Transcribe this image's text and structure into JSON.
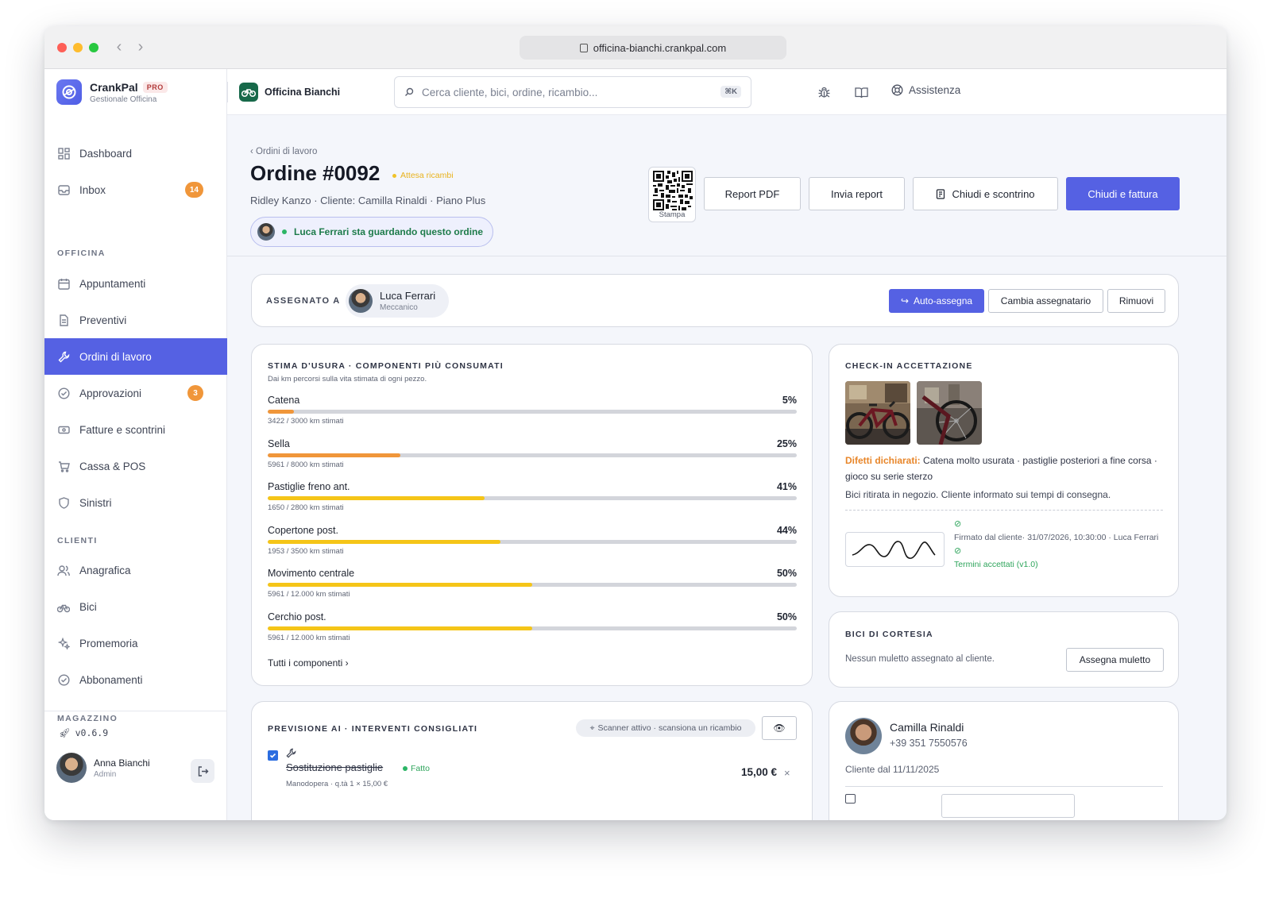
{
  "browser": {
    "url": "officina-bianchi.crankpal.com"
  },
  "brand": {
    "name": "CrankPal",
    "tier": "PRO",
    "subtitle": "Gestionale Officina"
  },
  "sidebar": {
    "items": [
      {
        "label": "Dashboard",
        "icon": "dashboard-icon"
      },
      {
        "label": "Inbox",
        "icon": "inbox-icon",
        "badge": "14"
      },
      {
        "label": "Appuntamenti",
        "icon": "calendar-icon"
      },
      {
        "label": "Preventivi",
        "icon": "document-icon"
      },
      {
        "label": "Ordini di lavoro",
        "icon": "wrench-icon",
        "active": true
      },
      {
        "label": "Approvazioni",
        "icon": "check-circle-icon",
        "badge": "3"
      },
      {
        "label": "Fatture e scontrini",
        "icon": "receipt-icon"
      },
      {
        "label": "Cassa & POS",
        "icon": "cart-icon"
      },
      {
        "label": "Sinistri",
        "icon": "shield-icon"
      },
      {
        "label": "Anagrafica",
        "icon": "users-icon"
      },
      {
        "label": "Bici",
        "icon": "bike-icon"
      },
      {
        "label": "Promemoria",
        "icon": "sparkle-icon"
      },
      {
        "label": "Abbonamenti",
        "icon": "check-circle-icon"
      }
    ],
    "sections": {
      "officina": "OFFICINA",
      "clienti": "CLIENTI",
      "magazzino": "MAGAZZINO"
    },
    "version": "v0.6.9",
    "user": {
      "name": "Anna Bianchi",
      "role": "Admin"
    }
  },
  "topbar": {
    "shop_name": "Officina Bianchi",
    "search_placeholder": "Cerca cliente, bici, ordine, ricambio...",
    "search_shortcut": "⌘K",
    "help_label": "Assistenza"
  },
  "order": {
    "breadcrumb": "‹ Ordini di lavoro",
    "title": "Ordine #0092",
    "status": "Attesa ricambi",
    "subtitle": "Ridley Kanzo · Cliente: Camilla Rinaldi · Piano Plus",
    "watching": "Luca Ferrari sta guardando questo ordine",
    "qr_label": "Stampa",
    "actions": {
      "report_pdf": "Report PDF",
      "send_report": "Invia report",
      "close_receipt": "Chiudi e scontrino",
      "close_invoice": "Chiudi e fattura"
    }
  },
  "assignment": {
    "label": "ASSEGNATO A",
    "name": "Luca Ferrari",
    "role": "Meccanico",
    "auto_assign": "Auto-assegna",
    "change": "Cambia assegnatario",
    "remove": "Rimuovi"
  },
  "wear": {
    "title": "STIMA D'USURA · COMPONENTI PIÙ CONSUMATI",
    "subtitle": "Dai km percorsi sulla vita stimata di ogni pezzo.",
    "items": [
      {
        "name": "Catena",
        "pct_label": "5%",
        "fraction": 0.05,
        "km": "3422 / 3000 km stimati",
        "color": "#f0963a"
      },
      {
        "name": "Sella",
        "pct_label": "25%",
        "fraction": 0.25,
        "km": "5961 / 8000 km stimati",
        "color": "#f0963a"
      },
      {
        "name": "Pastiglie freno ant.",
        "pct_label": "41%",
        "fraction": 0.41,
        "km": "1650 / 2800 km stimati",
        "color": "#f5c518"
      },
      {
        "name": "Copertone post.",
        "pct_label": "44%",
        "fraction": 0.44,
        "km": "1953 / 3500 km stimati",
        "color": "#f5c518"
      },
      {
        "name": "Movimento centrale",
        "pct_label": "50%",
        "fraction": 0.5,
        "km": "5961 / 12.000 km stimati",
        "color": "#f5c518"
      },
      {
        "name": "Cerchio post.",
        "pct_label": "50%",
        "fraction": 0.5,
        "km": "5961 / 12.000 km stimati",
        "color": "#f5c518"
      }
    ],
    "all_link": "Tutti i componenti ›"
  },
  "checkin": {
    "title": "CHECK-IN ACCETTAZIONE",
    "defects_label": "Difetti dichiarati:",
    "defects_text": "Catena molto usurata · pastiglie posteriori a fine corsa · gioco su serie sterzo",
    "note": "Bici ritirata in negozio. Cliente informato sui tempi di consegna.",
    "signed": "Firmato dal cliente· 31/07/2026, 10:30:00 · Luca Ferrari",
    "terms": "Termini accettati (v1.0)"
  },
  "courtesy": {
    "title": "BICI DI CORTESIA",
    "text": "Nessun muletto assegnato al cliente.",
    "button": "Assegna muletto"
  },
  "ai": {
    "title": "PREVISIONE AI · INTERVENTI CONSIGLIATI",
    "scanner": "Scanner attivo · scansiona un ricambio",
    "item": {
      "name": "Sostituzione pastiglie",
      "status": "Fatto",
      "meta": "Manodopera · q.tà 1 × 15,00 €",
      "price": "15,00 €"
    }
  },
  "customer": {
    "name": "Camilla Rinaldi",
    "phone": "+39 351 7550576",
    "since": "Cliente dal 11/11/2025"
  }
}
